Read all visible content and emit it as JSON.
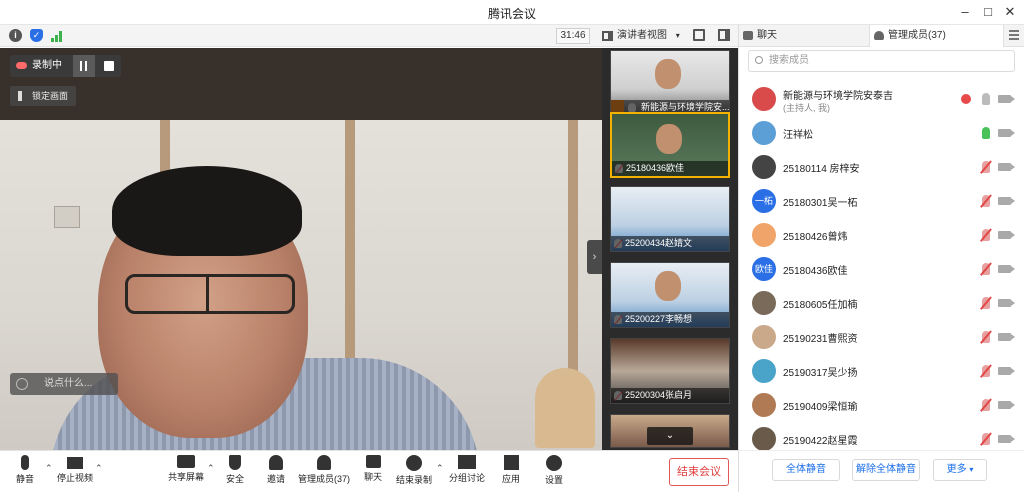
{
  "window": {
    "title": "腾讯会议",
    "controls": [
      "minimize-icon",
      "maximize-icon",
      "close-icon"
    ]
  },
  "infobar": {
    "icons": [
      "info-icon",
      "shield-icon",
      "signal-icon"
    ],
    "timer": "31:46",
    "view_label": "演讲者视图"
  },
  "main_video": {
    "recording_label": "录制中",
    "lock_label": "锁定画面",
    "chat_placeholder": "说点什么..."
  },
  "thumbnails": [
    {
      "name": "新能源与环境学院安...",
      "host": true,
      "muted": false,
      "active": false
    },
    {
      "name": "25180436欧佳",
      "host": false,
      "muted": true,
      "active": true
    },
    {
      "name": "25200434赵婧文",
      "host": false,
      "muted": true,
      "active": false
    },
    {
      "name": "25200227李畅想",
      "host": false,
      "muted": true,
      "active": false
    },
    {
      "name": "25200304张启月",
      "host": false,
      "muted": true,
      "active": false
    }
  ],
  "toolbar": {
    "mute_label": "静音",
    "stop_video_label": "停止视频",
    "share_label": "共享屏幕",
    "security_label": "安全",
    "invite_label": "邀请",
    "members_label": "管理成员(37)",
    "chat_label": "聊天",
    "stop_rec_label": "结束录制",
    "breakout_label": "分组讨论",
    "apps_label": "应用",
    "settings_label": "设置",
    "end_meeting_label": "结束会议"
  },
  "panel": {
    "tab_chat": "聊天",
    "tab_members": "管理成员(37)",
    "search_placeholder": "搜索成员",
    "members": [
      {
        "name": "新能源与环境学院安泰吉",
        "sub": "(主持人, 我)",
        "avatar_text": "",
        "avatar_color": "#d94a4a",
        "mic": "idle"
      },
      {
        "name": "汪祥松",
        "sub": "",
        "avatar_text": "",
        "avatar_color": "#5c9fd6",
        "mic": "on"
      },
      {
        "name": "25180114 房梓安",
        "sub": "",
        "avatar_text": "",
        "avatar_color": "#444444",
        "mic": "off"
      },
      {
        "name": "25180301吴一柘",
        "sub": "",
        "avatar_text": "一柘",
        "avatar_color": "#2b6fe6",
        "mic": "off"
      },
      {
        "name": "25180426曾炜",
        "sub": "",
        "avatar_text": "",
        "avatar_color": "#f0a46a",
        "mic": "off"
      },
      {
        "name": "25180436欧佳",
        "sub": "",
        "avatar_text": "欧佳",
        "avatar_color": "#2b6fe6",
        "mic": "off"
      },
      {
        "name": "25180605任加楠",
        "sub": "",
        "avatar_text": "",
        "avatar_color": "#7a6a5a",
        "mic": "off"
      },
      {
        "name": "25190231曹熙资",
        "sub": "",
        "avatar_text": "",
        "avatar_color": "#c9a98a",
        "mic": "off"
      },
      {
        "name": "25190317吴少扬",
        "sub": "",
        "avatar_text": "",
        "avatar_color": "#4aa3c8",
        "mic": "off"
      },
      {
        "name": "25190409梁恒瑜",
        "sub": "",
        "avatar_text": "",
        "avatar_color": "#b07a55",
        "mic": "off"
      },
      {
        "name": "25190422赵星霞",
        "sub": "",
        "avatar_text": "",
        "avatar_color": "#6a5a4a",
        "mic": "off"
      }
    ],
    "mute_all_label": "全体静音",
    "unmute_all_label": "解除全体静音",
    "more_label": "更多"
  },
  "colors": {
    "accent": "#1a6fe8",
    "end_red": "#e03c3c",
    "active_thumb": "#f2b200"
  }
}
